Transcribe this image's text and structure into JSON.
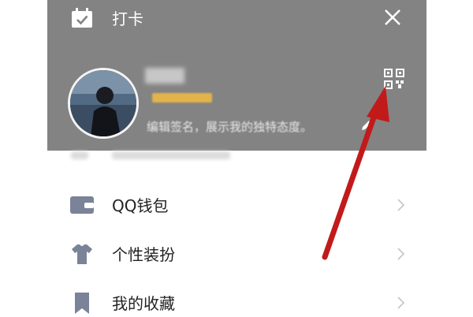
{
  "header": {
    "punch_label": "打卡",
    "bg_color": "#838383"
  },
  "profile": {
    "signature": "编辑签名，展示我的独特态度。"
  },
  "menu": [
    {
      "label": "QQ钱包",
      "icon": "wallet-icon"
    },
    {
      "label": "个性装扮",
      "icon": "tshirt-icon"
    },
    {
      "label": "我的收藏",
      "icon": "bookmark-icon"
    }
  ],
  "colors": {
    "menu_icon": "#7b8398",
    "annotation_arrow": "#c21a1a",
    "level_bar": "#e3b44c"
  }
}
